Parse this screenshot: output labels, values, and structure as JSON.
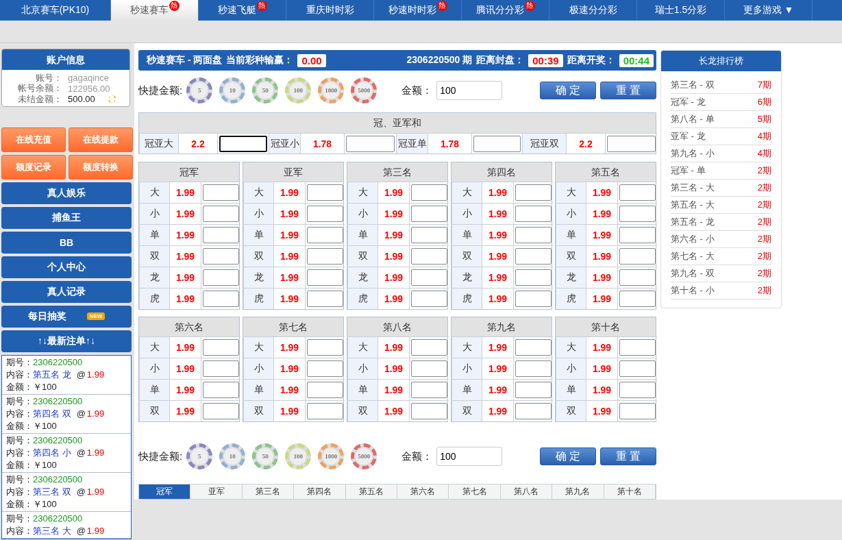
{
  "nav": [
    {
      "label": "北京赛车(PK10)",
      "selected": false
    },
    {
      "label": "秒速赛车",
      "selected": true,
      "badge": "熱"
    },
    {
      "label": "秒速飞艇",
      "selected": false,
      "badge": "熱"
    },
    {
      "label": "重庆时时彩",
      "selected": false
    },
    {
      "label": "秒速时时彩",
      "selected": false,
      "badge": "熱"
    },
    {
      "label": "腾讯分分彩",
      "selected": false,
      "badge": "熱"
    },
    {
      "label": "极速分分彩",
      "selected": false
    },
    {
      "label": "瑞士1.5分彩",
      "selected": false
    },
    {
      "label": "更多游戏 ▼",
      "selected": false
    }
  ],
  "account": {
    "title": "账户信息",
    "rows": [
      {
        "label": "账号：",
        "value": "gagaqince",
        "muted": true
      },
      {
        "label": "帐号余额：",
        "value": "122956.00",
        "muted": true
      },
      {
        "label": "未结金额：",
        "value": "500.00",
        "muted": false
      }
    ]
  },
  "actions": [
    "在线充值",
    "在线提款",
    "额度记录",
    "额度转换"
  ],
  "menu": [
    {
      "label": "真人娱乐"
    },
    {
      "label": "捕鱼王"
    },
    {
      "label": "BB"
    },
    {
      "label": "个人中心"
    },
    {
      "label": "真人记录"
    },
    {
      "label": "每日抽奖",
      "badge": "NEW"
    },
    {
      "label": "↑↓最新注单↑↓"
    }
  ],
  "bets": [
    {
      "issue_label": "期号：",
      "issue": "2306220500",
      "content_label": "内容：",
      "content": "第五名 龙",
      "at": "@",
      "odds": "1.99",
      "amount_label": "金额：",
      "amount": "￥100"
    },
    {
      "issue_label": "期号：",
      "issue": "2306220500",
      "content_label": "内容：",
      "content": "第四名 双",
      "at": "@",
      "odds": "1.99",
      "amount_label": "金额：",
      "amount": "￥100"
    },
    {
      "issue_label": "期号：",
      "issue": "2306220500",
      "content_label": "内容：",
      "content": "第四名 小",
      "at": "@",
      "odds": "1.99",
      "amount_label": "金额：",
      "amount": "￥100"
    },
    {
      "issue_label": "期号：",
      "issue": "2306220500",
      "content_label": "内容：",
      "content": "第三名 双",
      "at": "@",
      "odds": "1.99",
      "amount_label": "金额：",
      "amount": "￥100"
    },
    {
      "issue_label": "期号：",
      "issue": "2306220500",
      "content_label": "内容：",
      "content": "第三名 大",
      "at": "@",
      "odds": "1.99"
    }
  ],
  "header": {
    "game": "秒速赛车 - 两面盘",
    "profit_label": "当前彩种输赢：",
    "profit": "0.00",
    "issue": "2306220500 期",
    "close_label": "距离封盘：",
    "close": "00:39",
    "draw_label": "距离开奖：",
    "draw": "00:44"
  },
  "quick_bets": [
    {
      "label": "快捷金额:",
      "chips": [
        {
          "value": "5",
          "color": "#8a84c8"
        },
        {
          "value": "10",
          "color": "#8fb0d8"
        },
        {
          "value": "50",
          "color": "#8cc48a"
        },
        {
          "value": "100",
          "color": "#c8d880"
        },
        {
          "value": "1000",
          "color": "#f0a060"
        },
        {
          "value": "5000",
          "color": "#e06a6a"
        }
      ],
      "amount_label": "金额：",
      "amount": "100",
      "confirm": "确 定",
      "reset": "重 置"
    },
    {
      "label": "快捷金额:",
      "chips": [
        {
          "value": "5",
          "color": "#8a84c8"
        },
        {
          "value": "10",
          "color": "#8fb0d8"
        },
        {
          "value": "50",
          "color": "#8cc48a"
        },
        {
          "value": "100",
          "color": "#c8d880"
        },
        {
          "value": "1000",
          "color": "#f0a060"
        },
        {
          "value": "5000",
          "color": "#e06a6a"
        }
      ],
      "amount_label": "金额：",
      "amount": "100",
      "confirm": "确 定",
      "reset": "重 置"
    }
  ],
  "sum": {
    "title": "冠、亚军和",
    "items": [
      {
        "name": "冠亚大",
        "odds": "2.2",
        "focused": true
      },
      {
        "name": "冠亚小",
        "odds": "1.78",
        "focused": false
      },
      {
        "name": "冠亚单",
        "odds": "1.78",
        "focused": false
      },
      {
        "name": "冠亚双",
        "odds": "2.2",
        "focused": false
      }
    ]
  },
  "positions": [
    {
      "name": "冠军",
      "rows": [
        {
          "name": "大",
          "odds": "1.99"
        },
        {
          "name": "小",
          "odds": "1.99"
        },
        {
          "name": "单",
          "odds": "1.99"
        },
        {
          "name": "双",
          "odds": "1.99"
        },
        {
          "name": "龙",
          "odds": "1.99"
        },
        {
          "name": "虎",
          "odds": "1.99"
        }
      ]
    },
    {
      "name": "亚军",
      "rows": [
        {
          "name": "大",
          "odds": "1.99"
        },
        {
          "name": "小",
          "odds": "1.99"
        },
        {
          "name": "单",
          "odds": "1.99"
        },
        {
          "name": "双",
          "odds": "1.99"
        },
        {
          "name": "龙",
          "odds": "1.99"
        },
        {
          "name": "虎",
          "odds": "1.99"
        }
      ]
    },
    {
      "name": "第三名",
      "rows": [
        {
          "name": "大",
          "odds": "1.99"
        },
        {
          "name": "小",
          "odds": "1.99"
        },
        {
          "name": "单",
          "odds": "1.99"
        },
        {
          "name": "双",
          "odds": "1.99"
        },
        {
          "name": "龙",
          "odds": "1.99"
        },
        {
          "name": "虎",
          "odds": "1.99"
        }
      ]
    },
    {
      "name": "第四名",
      "rows": [
        {
          "name": "大",
          "odds": "1.99"
        },
        {
          "name": "小",
          "odds": "1.99"
        },
        {
          "name": "单",
          "odds": "1.99"
        },
        {
          "name": "双",
          "odds": "1.99"
        },
        {
          "name": "龙",
          "odds": "1.99"
        },
        {
          "name": "虎",
          "odds": "1.99"
        }
      ]
    },
    {
      "name": "第五名",
      "rows": [
        {
          "name": "大",
          "odds": "1.99"
        },
        {
          "name": "小",
          "odds": "1.99"
        },
        {
          "name": "单",
          "odds": "1.99"
        },
        {
          "name": "双",
          "odds": "1.99"
        },
        {
          "name": "龙",
          "odds": "1.99"
        },
        {
          "name": "虎",
          "odds": "1.99"
        }
      ]
    },
    {
      "name": "第六名",
      "rows": [
        {
          "name": "大",
          "odds": "1.99"
        },
        {
          "name": "小",
          "odds": "1.99"
        },
        {
          "name": "单",
          "odds": "1.99"
        },
        {
          "name": "双",
          "odds": "1.99"
        }
      ]
    },
    {
      "name": "第七名",
      "rows": [
        {
          "name": "大",
          "odds": "1.99"
        },
        {
          "name": "小",
          "odds": "1.99"
        },
        {
          "name": "单",
          "odds": "1.99"
        },
        {
          "name": "双",
          "odds": "1.99"
        }
      ]
    },
    {
      "name": "第八名",
      "rows": [
        {
          "name": "大",
          "odds": "1.99"
        },
        {
          "name": "小",
          "odds": "1.99"
        },
        {
          "name": "单",
          "odds": "1.99"
        },
        {
          "name": "双",
          "odds": "1.99"
        }
      ]
    },
    {
      "name": "第九名",
      "rows": [
        {
          "name": "大",
          "odds": "1.99"
        },
        {
          "name": "小",
          "odds": "1.99"
        },
        {
          "name": "单",
          "odds": "1.99"
        },
        {
          "name": "双",
          "odds": "1.99"
        }
      ]
    },
    {
      "name": "第十名",
      "rows": [
        {
          "name": "大",
          "odds": "1.99"
        },
        {
          "name": "小",
          "odds": "1.99"
        },
        {
          "name": "单",
          "odds": "1.99"
        },
        {
          "name": "双",
          "odds": "1.99"
        }
      ]
    }
  ],
  "bottom_tabs": [
    {
      "label": "冠军",
      "selected": true
    },
    {
      "label": "亚军",
      "selected": false
    },
    {
      "label": "第三名",
      "selected": false
    },
    {
      "label": "第四名",
      "selected": false
    },
    {
      "label": "第五名",
      "selected": false
    },
    {
      "label": "第六名",
      "selected": false
    },
    {
      "label": "第七名",
      "selected": false
    },
    {
      "label": "第八名",
      "selected": false
    },
    {
      "label": "第九名",
      "selected": false
    },
    {
      "label": "第十名",
      "selected": false
    }
  ],
  "ranking": {
    "title": "长龙排行榜",
    "items": [
      {
        "name": "第三名 - 双",
        "count": "7期"
      },
      {
        "name": "冠军 - 龙",
        "count": "6期"
      },
      {
        "name": "第八名 - 单",
        "count": "5期"
      },
      {
        "name": "亚军 - 龙",
        "count": "4期"
      },
      {
        "name": "第九名 - 小",
        "count": "4期"
      },
      {
        "name": "冠军 - 单",
        "count": "2期"
      },
      {
        "name": "第三名 - 大",
        "count": "2期"
      },
      {
        "name": "第五名 - 大",
        "count": "2期"
      },
      {
        "name": "第五名 - 龙",
        "count": "2期"
      },
      {
        "name": "第六名 - 小",
        "count": "2期"
      },
      {
        "name": "第七名 - 大",
        "count": "2期"
      },
      {
        "name": "第九名 - 双",
        "count": "2期"
      },
      {
        "name": "第十名 - 小",
        "count": "2期"
      }
    ]
  }
}
